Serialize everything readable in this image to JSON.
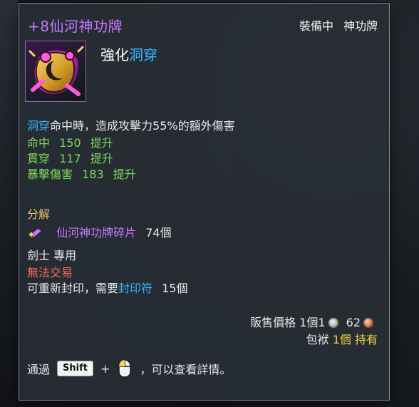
{
  "tooltip": {
    "title": "+8仙河神功牌",
    "equip_status": {
      "equipped_label": "裝備中",
      "category_label": "神功牌"
    },
    "icon_name": "talisman-icon",
    "enhance_header": {
      "prefix": "強化",
      "highlight": "洞穿"
    },
    "effect": {
      "trigger": "洞穿",
      "text": "命中時，造成攻擊力55%的額外傷害"
    },
    "stats": [
      {
        "name": "命中",
        "value": "150",
        "suffix": "提升"
      },
      {
        "name": "貫穿",
        "value": "117",
        "suffix": "提升"
      },
      {
        "name": "暴擊傷害",
        "value": "183",
        "suffix": "提升"
      }
    ],
    "decompose": {
      "label": "分解",
      "item_name": "仙河神功牌碎片",
      "count": "74個"
    },
    "restrictions": {
      "class_only": "劍士  專用",
      "no_trade": "無法交易",
      "reseal_prefix": "可重新封印，需要",
      "reseal_item": "封印符",
      "reseal_count": "15個"
    },
    "sell": {
      "label": "販售價格",
      "count": "1個",
      "silver": "1",
      "copper": "62"
    },
    "inventory": {
      "label": "包袱",
      "count": "1個",
      "status": "持有"
    },
    "hint": {
      "prefix": "通過",
      "key": "Shift",
      "plus": "+",
      "suffix": "，可以查看詳情。"
    }
  },
  "colors": {
    "title": "#c679ff",
    "cyan": "#36b7ff",
    "green": "#7bdc5a",
    "gold": "#e3c26c",
    "red": "#ff6b5a",
    "yellow": "#f2d24a"
  }
}
